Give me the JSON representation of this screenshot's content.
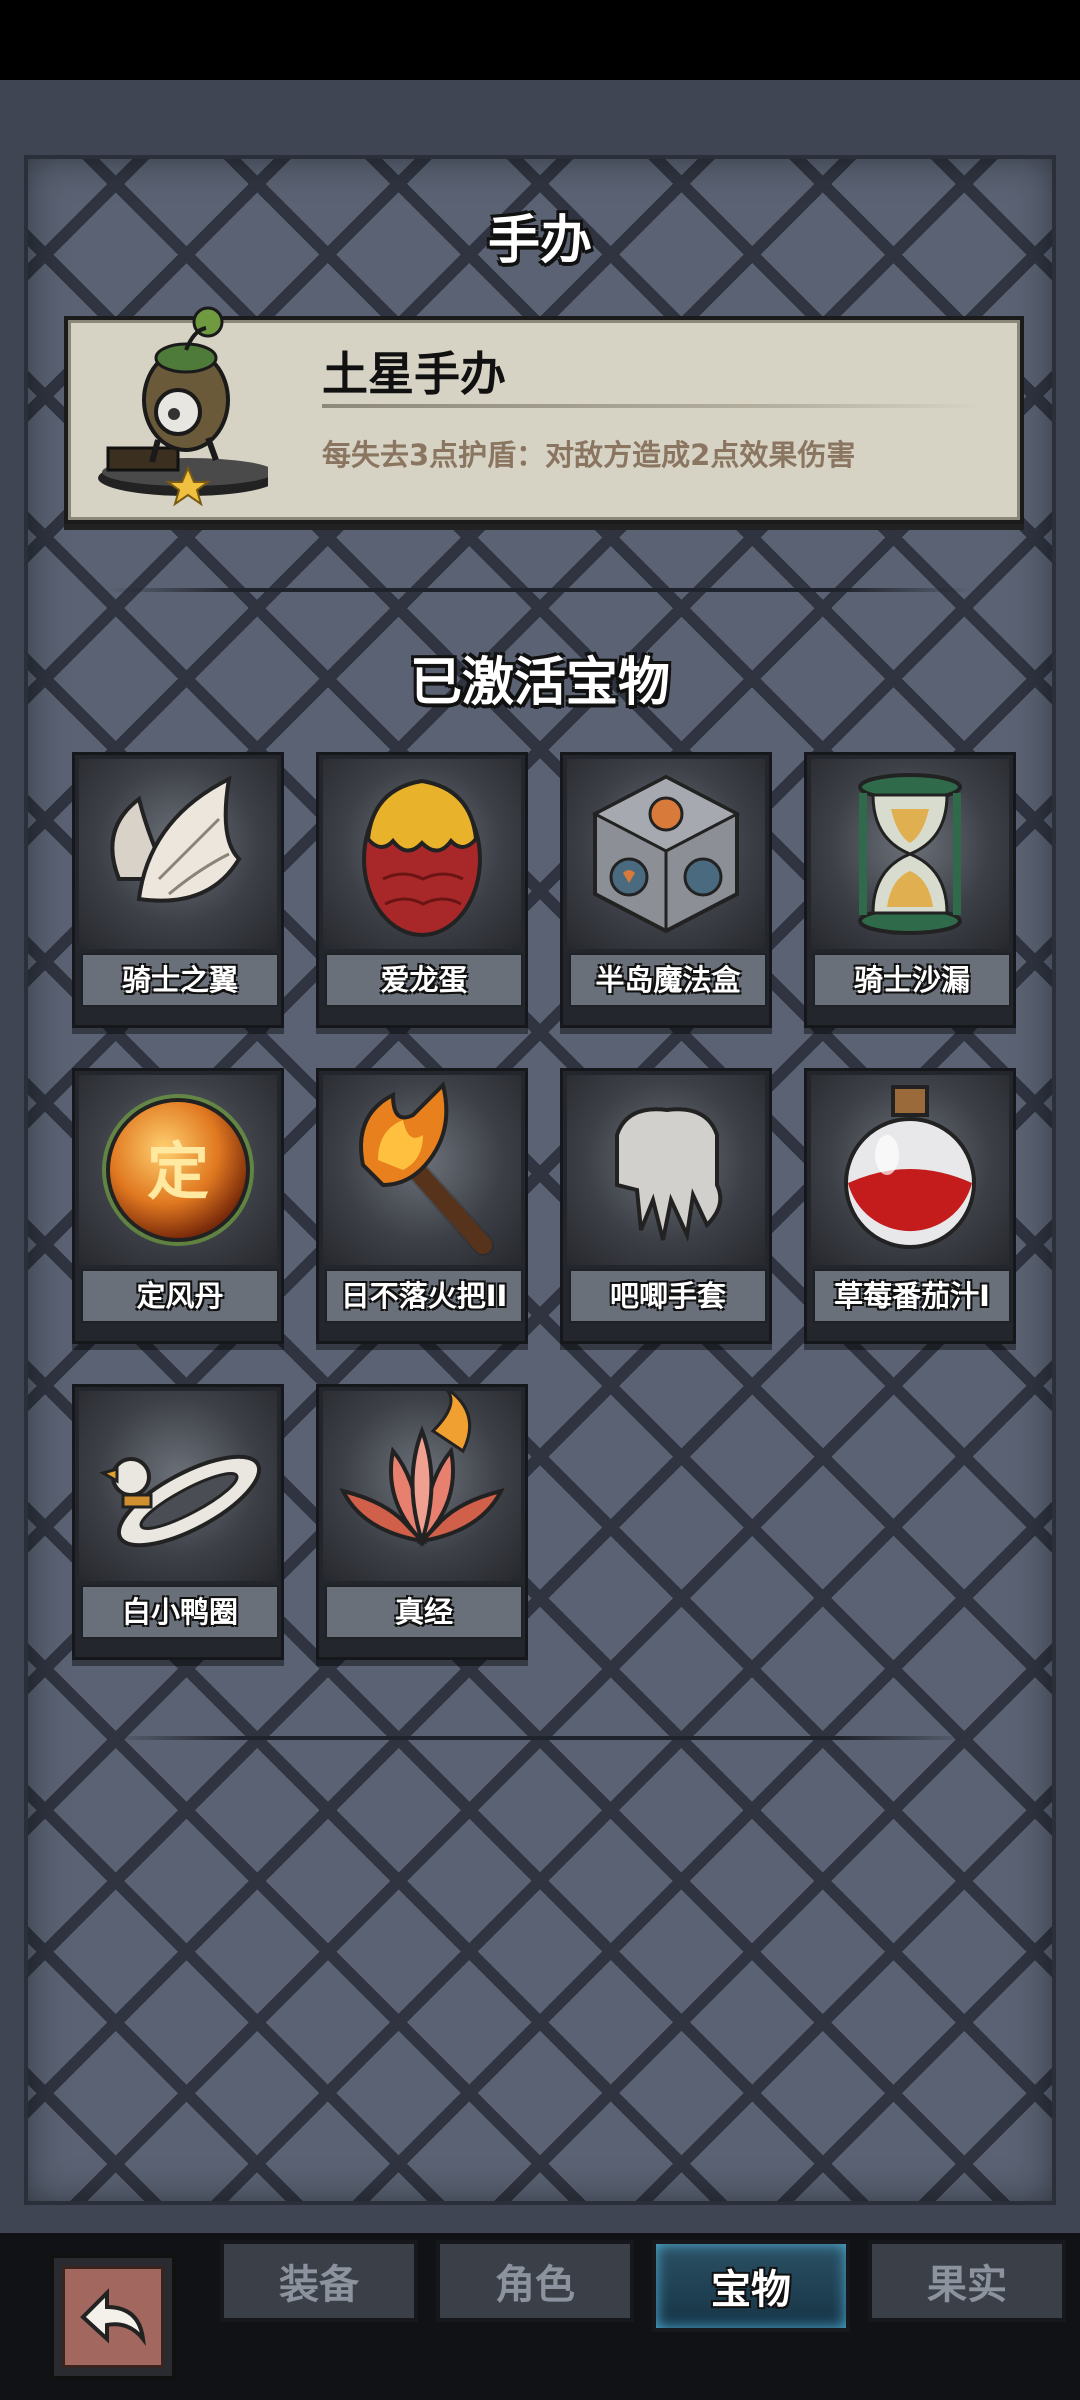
{
  "figure_section": {
    "title": "手办",
    "name": "土星手办",
    "description": "每失去3点护盾：对敌方造成2点效果伤害",
    "stars": 1
  },
  "treasure_section": {
    "title": "已激活宝物",
    "items": [
      {
        "label": "骑士之翼",
        "icon": "wings-icon"
      },
      {
        "label": "爱龙蛋",
        "icon": "dragon-egg-icon"
      },
      {
        "label": "半岛魔法盒",
        "icon": "magic-box-icon"
      },
      {
        "label": "骑士沙漏",
        "icon": "hourglass-icon"
      },
      {
        "label": "定风丹",
        "icon": "orb-icon",
        "glyph": "定"
      },
      {
        "label": "日不落火把II",
        "icon": "torch-icon"
      },
      {
        "label": "吧唧手套",
        "icon": "glove-icon"
      },
      {
        "label": "草莓番茄汁I",
        "icon": "potion-icon"
      },
      {
        "label": "白小鸭圈",
        "icon": "duck-ring-icon"
      },
      {
        "label": "真经",
        "icon": "lotus-icon"
      }
    ]
  },
  "nav": {
    "back_icon": "back-arrow-icon",
    "tabs": [
      "装备",
      "角色",
      "宝物",
      "果实"
    ],
    "active_tab": "宝物"
  }
}
